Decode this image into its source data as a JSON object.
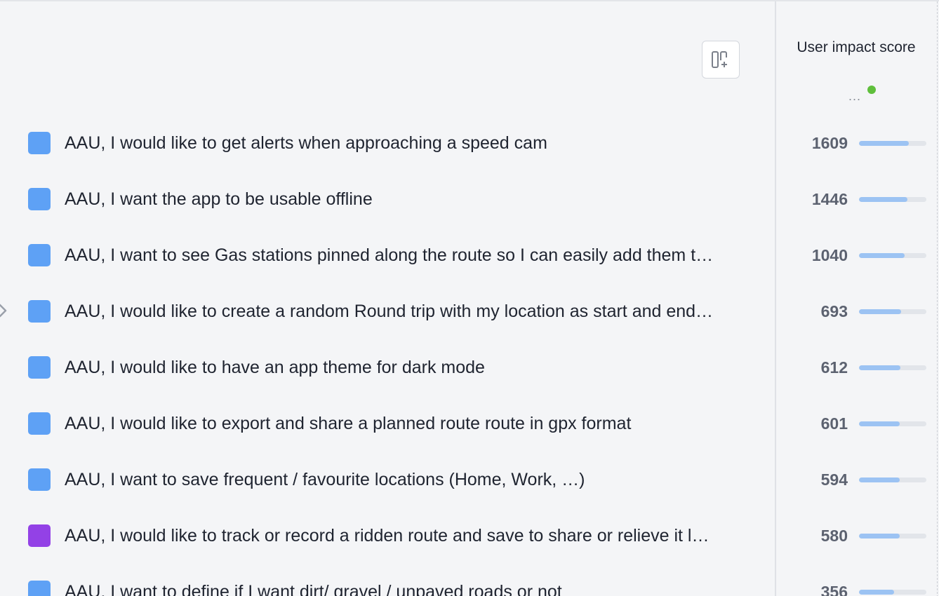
{
  "header": {
    "column_title": "User impact score",
    "column_menu_label": "...",
    "status_color": "#5fbf3c"
  },
  "toolbar": {
    "add_column_icon": "add-column-icon"
  },
  "colors": {
    "blue_swatch": "#5ea1f5",
    "purple_swatch": "#9341e6",
    "bar_fill": "#9cc3f3"
  },
  "rows": [
    {
      "title": "AAU, I would like to get alerts when approaching a speed cam",
      "score": "1609",
      "fraction": 0.74,
      "color": "#5ea1f5"
    },
    {
      "title": "AAU, I want the app to be usable offline",
      "score": "1446",
      "fraction": 0.72,
      "color": "#5ea1f5"
    },
    {
      "title": "AAU, I want to see Gas stations pinned along the route so I can easily add them t…",
      "score": "1040",
      "fraction": 0.68,
      "color": "#5ea1f5"
    },
    {
      "title": "AAU, I would like to create a random Round trip with my location as start and end…",
      "score": "693",
      "fraction": 0.62,
      "color": "#5ea1f5"
    },
    {
      "title": "AAU, I would like to have an app theme for dark mode",
      "score": "612",
      "fraction": 0.61,
      "color": "#5ea1f5"
    },
    {
      "title": "AAU, I would like to export and share a planned route route in gpx format",
      "score": "601",
      "fraction": 0.6,
      "color": "#5ea1f5"
    },
    {
      "title": "AAU, I want to save frequent / favourite locations (Home, Work, …)",
      "score": "594",
      "fraction": 0.6,
      "color": "#5ea1f5"
    },
    {
      "title": "AAU, I would like to track or record a ridden route and save to share or relieve it l…",
      "score": "580",
      "fraction": 0.6,
      "color": "#9341e6"
    },
    {
      "title": "AAU, I want to define if I want dirt/ gravel / unpaved roads or not",
      "score": "356",
      "fraction": 0.52,
      "color": "#5ea1f5"
    }
  ]
}
